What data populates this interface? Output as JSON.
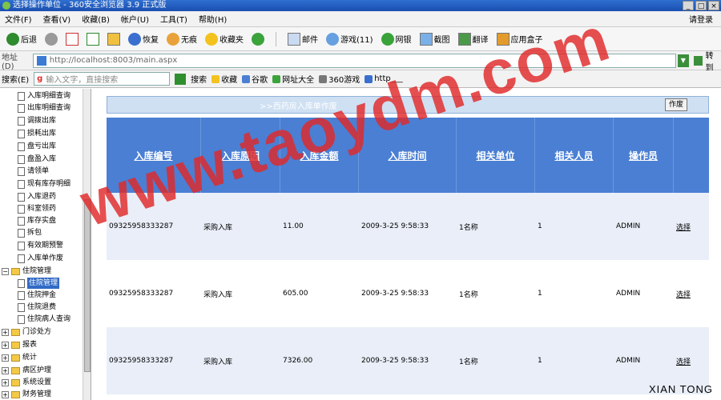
{
  "window": {
    "title": "选择操作单位 - 360安全浏览器 3.9 正式版"
  },
  "menu": {
    "items": [
      "文件(F)",
      "查看(V)",
      "收藏(B)",
      "帐户(U)",
      "工具(T)",
      "帮助(H)"
    ],
    "login": "请登录"
  },
  "toolbar": {
    "back": "后退",
    "restore": "恢复",
    "nofx": "无痕",
    "favorites": "收藏夹",
    "mail": "邮件",
    "games": "游戏(11)",
    "netbank": "网银",
    "screenshot": "截图",
    "translate": "翻译",
    "appbox": "应用盒子"
  },
  "address": {
    "label": "地址(D)",
    "url": "http://localhost:8003/main.aspx",
    "go": "转到"
  },
  "searchbar": {
    "label": "搜索(E)",
    "placeholder": "输入文字，直接搜索",
    "search": "搜索",
    "favs": [
      "收藏",
      "谷歌",
      "网址大全",
      "360游戏",
      "http___"
    ]
  },
  "sidebar": {
    "items": [
      {
        "label": "入库明细查询",
        "kind": "doc"
      },
      {
        "label": "出库明细查询",
        "kind": "doc"
      },
      {
        "label": "调拨出库",
        "kind": "doc"
      },
      {
        "label": "损耗出库",
        "kind": "doc"
      },
      {
        "label": "盘亏出库",
        "kind": "doc"
      },
      {
        "label": "盘盈入库",
        "kind": "doc"
      },
      {
        "label": "请领单",
        "kind": "doc"
      },
      {
        "label": "现有库存明细",
        "kind": "doc"
      },
      {
        "label": "入库退药",
        "kind": "doc"
      },
      {
        "label": "科室领药",
        "kind": "doc"
      },
      {
        "label": "库存实盘",
        "kind": "doc"
      },
      {
        "label": "拆包",
        "kind": "doc"
      },
      {
        "label": "有效期预警",
        "kind": "doc"
      },
      {
        "label": "入库单作废",
        "kind": "doc"
      },
      {
        "label": "住院管理",
        "kind": "folder-open"
      },
      {
        "label": "住院管理",
        "kind": "doc-selected"
      },
      {
        "label": "住院押金",
        "kind": "doc"
      },
      {
        "label": "住院退费",
        "kind": "doc"
      },
      {
        "label": "住院病人查询",
        "kind": "doc"
      },
      {
        "label": "门诊处方",
        "kind": "folder"
      },
      {
        "label": "报表",
        "kind": "folder"
      },
      {
        "label": "统计",
        "kind": "folder"
      },
      {
        "label": "病区护理",
        "kind": "folder"
      },
      {
        "label": "系统设置",
        "kind": "folder"
      },
      {
        "label": "财务管理",
        "kind": "folder"
      }
    ]
  },
  "panel": {
    "title": ">>西药房入库单作废",
    "button": "作废"
  },
  "table": {
    "headers": [
      "入库编号",
      "入库原因",
      "入库金额",
      "入库时间",
      "相关单位",
      "相关人员",
      "操作员",
      ""
    ],
    "rows": [
      [
        "09325958333287",
        "采购入库",
        "11.00",
        "2009-3-25 9:58:33",
        "1名称",
        "1",
        "ADMIN",
        "选择"
      ],
      [
        "09325958333287",
        "采购入库",
        "605.00",
        "2009-3-25 9:58:33",
        "1名称",
        "1",
        "ADMIN",
        "选择"
      ],
      [
        "09325958333287",
        "采购入库",
        "7326.00",
        "2009-3-25 9:58:33",
        "1名称",
        "1",
        "ADMIN",
        "选择"
      ]
    ]
  },
  "overlay": {
    "watermark": "www.taoydm.com",
    "credit": "XIAN TONG"
  }
}
